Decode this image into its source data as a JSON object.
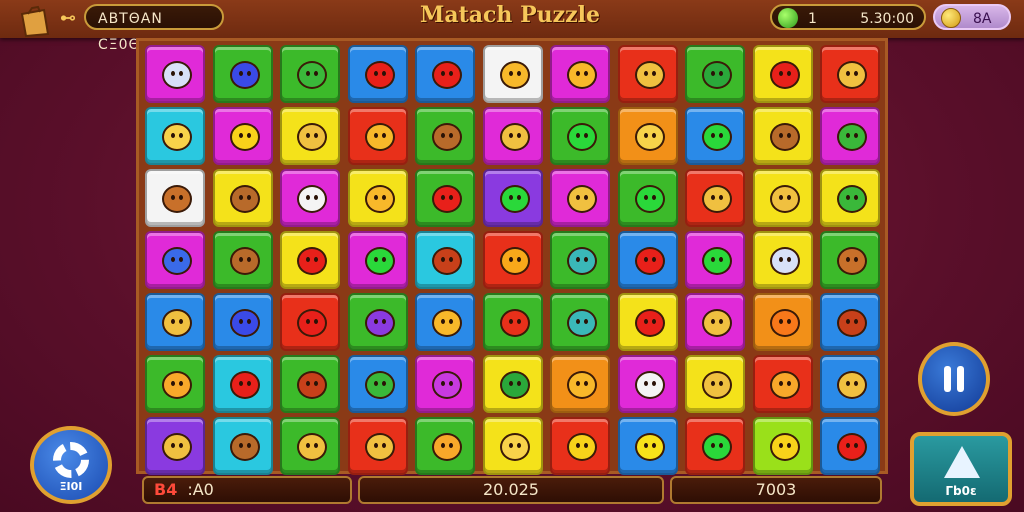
{
  "header": {
    "keys_label": "⊷",
    "left_pill": "ΑΒΤΘΑΝ CΞ0ΘΞ5",
    "title": "Matach Puzzle",
    "timer_count": "1",
    "timer_value": "5.30:00",
    "coins": "8A"
  },
  "footer": {
    "tag": "B4",
    "left_value": ":A0",
    "score": "20.025",
    "right_value": "7003"
  },
  "buttons": {
    "settings_label": "ΞI0I",
    "tool_label": "Γb0ε"
  },
  "colors": {
    "blue": "#2a8ae8",
    "green": "#3cba2a",
    "red": "#e8301a",
    "magenta": "#e02ad8",
    "yellow": "#f4e21a",
    "orange": "#f29018",
    "purple": "#8a3ae0",
    "cyan": "#2ac8e0",
    "white": "#f4f4f4",
    "lime": "#9ae01a"
  },
  "board": {
    "rows": 7,
    "cols": 11,
    "tiles": [
      [
        [
          "magenta",
          "calendar-icon"
        ],
        [
          "green",
          "ball-icon"
        ],
        [
          "green",
          "bubble-icon"
        ],
        [
          "blue",
          "heart-icon"
        ],
        [
          "blue",
          "heart-icon"
        ],
        [
          "white",
          "sun-face-icon"
        ],
        [
          "magenta",
          "sun-face-icon"
        ],
        [
          "red",
          "face-icon"
        ],
        [
          "green",
          "box-icon"
        ],
        [
          "yellow",
          "heart-icon"
        ],
        [
          "red",
          "face-icon"
        ]
      ],
      [
        [
          "cyan",
          "cat-icon"
        ],
        [
          "magenta",
          "lemon-icon"
        ],
        [
          "yellow",
          "face-icon"
        ],
        [
          "red",
          "sun-face-icon"
        ],
        [
          "green",
          "monkey-icon"
        ],
        [
          "magenta",
          "bug-icon"
        ],
        [
          "green",
          "star-icon"
        ],
        [
          "orange",
          "cat-icon"
        ],
        [
          "blue",
          "star-icon"
        ],
        [
          "yellow",
          "monkey-icon"
        ],
        [
          "magenta",
          "leaf-icon"
        ]
      ],
      [
        [
          "white",
          "bear-icon"
        ],
        [
          "yellow",
          "monkey-icon"
        ],
        [
          "magenta",
          "dog-icon"
        ],
        [
          "yellow",
          "sun-face-icon"
        ],
        [
          "green",
          "heart-icon"
        ],
        [
          "purple",
          "star-icon"
        ],
        [
          "magenta",
          "face-icon"
        ],
        [
          "green",
          "star-icon"
        ],
        [
          "red",
          "face-icon"
        ],
        [
          "yellow",
          "face-icon"
        ],
        [
          "yellow",
          "palm-icon"
        ]
      ],
      [
        [
          "magenta",
          "card-icon"
        ],
        [
          "green",
          "monkey-icon"
        ],
        [
          "yellow",
          "heart-icon"
        ],
        [
          "magenta",
          "star-icon"
        ],
        [
          "cyan",
          "house-icon"
        ],
        [
          "red",
          "splat-icon"
        ],
        [
          "green",
          "doc-icon"
        ],
        [
          "blue",
          "heart-icon"
        ],
        [
          "magenta",
          "star-icon"
        ],
        [
          "yellow",
          "calendar-icon"
        ],
        [
          "green",
          "bear-icon"
        ]
      ],
      [
        [
          "blue",
          "face-icon"
        ],
        [
          "blue",
          "ball-icon"
        ],
        [
          "red",
          "heart-icon"
        ],
        [
          "green",
          "grape-icon"
        ],
        [
          "blue",
          "squirrel-icon"
        ],
        [
          "green",
          "apple-icon"
        ],
        [
          "green",
          "doc-icon"
        ],
        [
          "yellow",
          "strawberry-icon"
        ],
        [
          "magenta",
          "face-icon"
        ],
        [
          "orange",
          "carrot-icon"
        ],
        [
          "blue",
          "house-icon"
        ]
      ],
      [
        [
          "green",
          "bird-icon"
        ],
        [
          "cyan",
          "heart-icon"
        ],
        [
          "green",
          "house-icon"
        ],
        [
          "blue",
          "virus-icon"
        ],
        [
          "magenta",
          "book-icon"
        ],
        [
          "yellow",
          "box-icon"
        ],
        [
          "orange",
          "sun-face-icon"
        ],
        [
          "magenta",
          "cube-icon"
        ],
        [
          "yellow",
          "face-icon"
        ],
        [
          "red",
          "bird-icon"
        ],
        [
          "blue",
          "face-icon"
        ]
      ],
      [
        [
          "purple",
          "face-icon"
        ],
        [
          "cyan",
          "monkey-icon"
        ],
        [
          "green",
          "face-icon"
        ],
        [
          "red",
          "face-icon"
        ],
        [
          "green",
          "bird-icon"
        ],
        [
          "yellow",
          "cat-icon"
        ],
        [
          "red",
          "cup-icon"
        ],
        [
          "blue",
          "bolt-icon"
        ],
        [
          "red",
          "star-icon"
        ],
        [
          "lime",
          "cup-icon"
        ],
        [
          "blue",
          "heart-icon"
        ]
      ]
    ]
  }
}
